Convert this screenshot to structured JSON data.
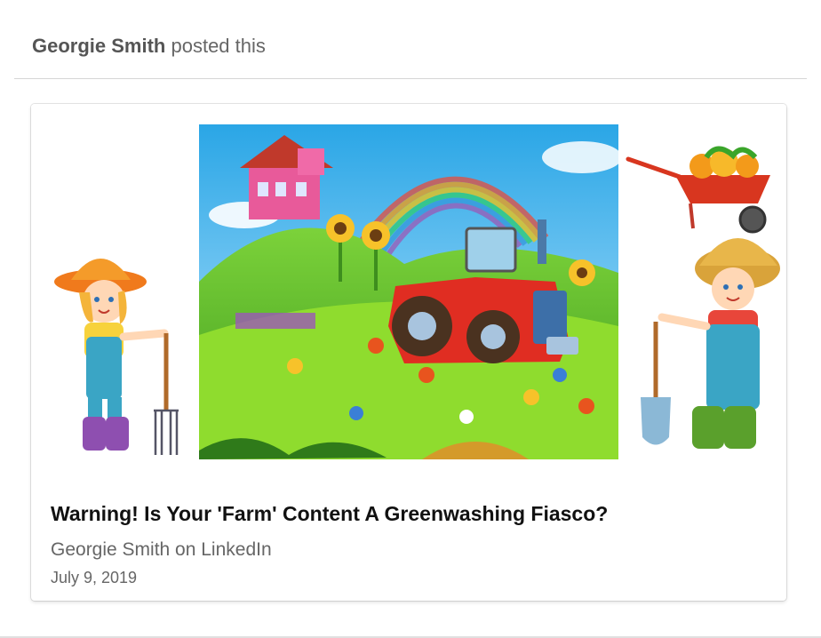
{
  "post": {
    "author": "Georgie Smith",
    "action": "posted this"
  },
  "article": {
    "title": "Warning! Is Your 'Farm' Content A Greenwashing Fiasco?",
    "source": "Georgie Smith on LinkedIn",
    "date": "July 9, 2019"
  },
  "colors": {
    "accent_text": "#666666",
    "title_text": "#111111",
    "card_border": "#d6d6d6"
  },
  "illustration": {
    "icons": [
      "farmer-girl-icon",
      "farm-scene-icon",
      "wheelbarrow-icon",
      "farmer-boy-icon",
      "red-tractor-icon",
      "rainbow-icon",
      "barn-house-icon",
      "sunflower-icon"
    ]
  }
}
